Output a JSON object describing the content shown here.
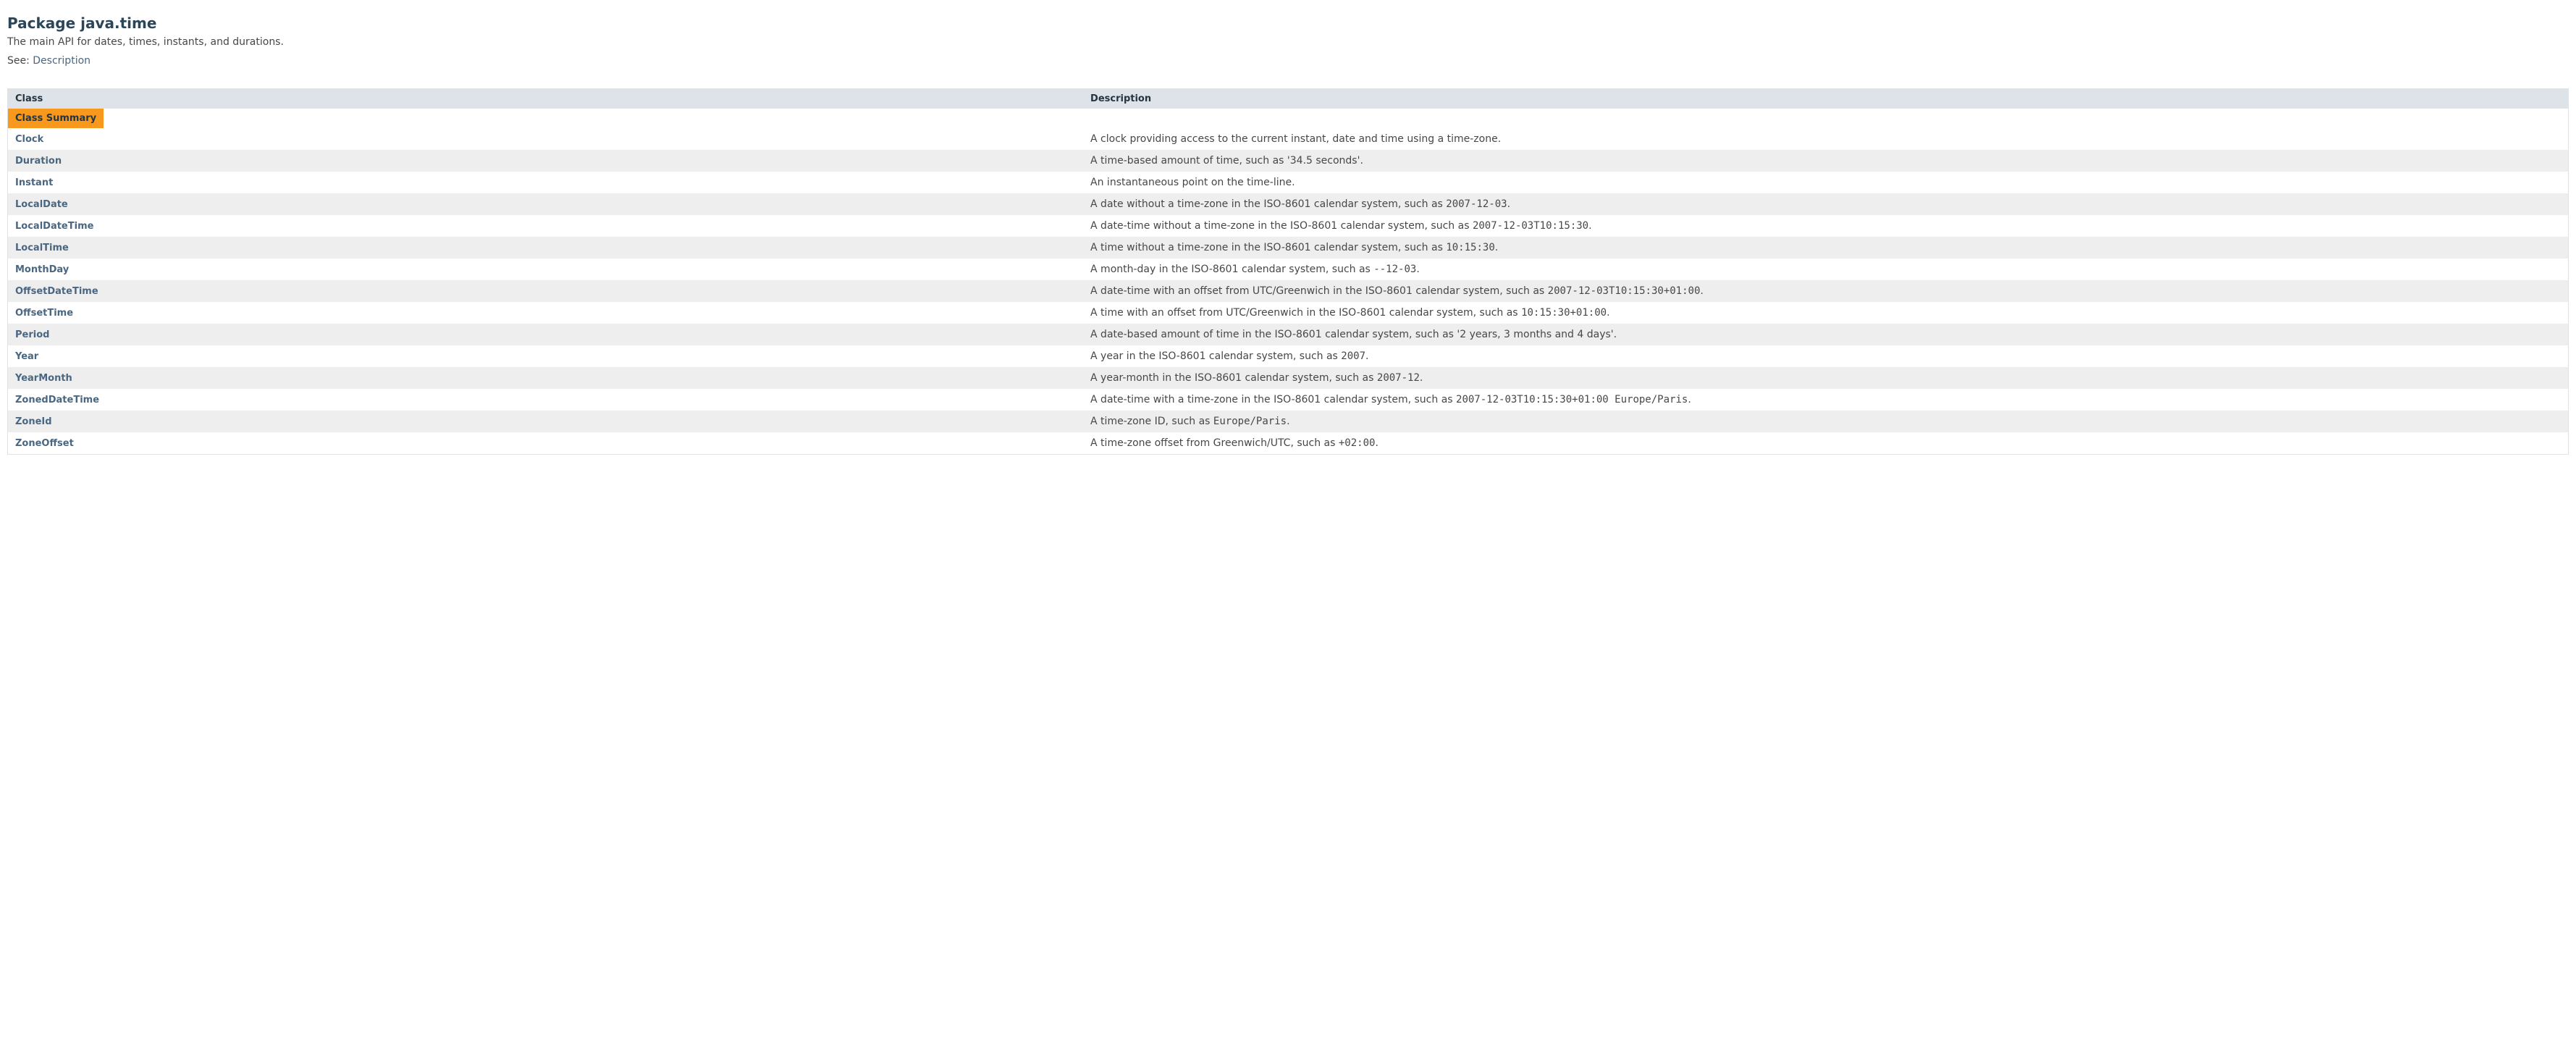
{
  "header": {
    "title": "Package java.time",
    "subtitle": "The main API for dates, times, instants, and durations.",
    "see_prefix": "See: ",
    "see_link": "Description"
  },
  "table": {
    "caption": "Class Summary",
    "col_class": "Class",
    "col_desc": "Description",
    "rows": [
      {
        "name": "Clock",
        "desc_pre": "A clock providing access to the current instant, date and time using a time-zone.",
        "code": "",
        "desc_post": ""
      },
      {
        "name": "Duration",
        "desc_pre": "A time-based amount of time, such as '34.5 seconds'.",
        "code": "",
        "desc_post": ""
      },
      {
        "name": "Instant",
        "desc_pre": "An instantaneous point on the time-line.",
        "code": "",
        "desc_post": ""
      },
      {
        "name": "LocalDate",
        "desc_pre": "A date without a time-zone in the ISO-8601 calendar system, such as ",
        "code": "2007-12-03",
        "desc_post": "."
      },
      {
        "name": "LocalDateTime",
        "desc_pre": "A date-time without a time-zone in the ISO-8601 calendar system, such as ",
        "code": "2007-12-03T10:15:30",
        "desc_post": "."
      },
      {
        "name": "LocalTime",
        "desc_pre": "A time without a time-zone in the ISO-8601 calendar system, such as ",
        "code": "10:15:30",
        "desc_post": "."
      },
      {
        "name": "MonthDay",
        "desc_pre": "A month-day in the ISO-8601 calendar system, such as ",
        "code": "--12-03",
        "desc_post": "."
      },
      {
        "name": "OffsetDateTime",
        "desc_pre": "A date-time with an offset from UTC/Greenwich in the ISO-8601 calendar system, such as ",
        "code": "2007-12-03T10:15:30+01:00",
        "desc_post": "."
      },
      {
        "name": "OffsetTime",
        "desc_pre": "A time with an offset from UTC/Greenwich in the ISO-8601 calendar system, such as ",
        "code": "10:15:30+01:00",
        "desc_post": "."
      },
      {
        "name": "Period",
        "desc_pre": "A date-based amount of time in the ISO-8601 calendar system, such as '2 years, 3 months and 4 days'.",
        "code": "",
        "desc_post": ""
      },
      {
        "name": "Year",
        "desc_pre": "A year in the ISO-8601 calendar system, such as ",
        "code": "2007",
        "desc_post": "."
      },
      {
        "name": "YearMonth",
        "desc_pre": "A year-month in the ISO-8601 calendar system, such as ",
        "code": "2007-12",
        "desc_post": "."
      },
      {
        "name": "ZonedDateTime",
        "desc_pre": "A date-time with a time-zone in the ISO-8601 calendar system, such as ",
        "code": "2007-12-03T10:15:30+01:00 Europe/Paris",
        "desc_post": "."
      },
      {
        "name": "ZoneId",
        "desc_pre": "A time-zone ID, such as ",
        "code": "Europe/Paris",
        "desc_post": "."
      },
      {
        "name": "ZoneOffset",
        "desc_pre": "A time-zone offset from Greenwich/UTC, such as ",
        "code": "+02:00",
        "desc_post": "."
      }
    ]
  }
}
